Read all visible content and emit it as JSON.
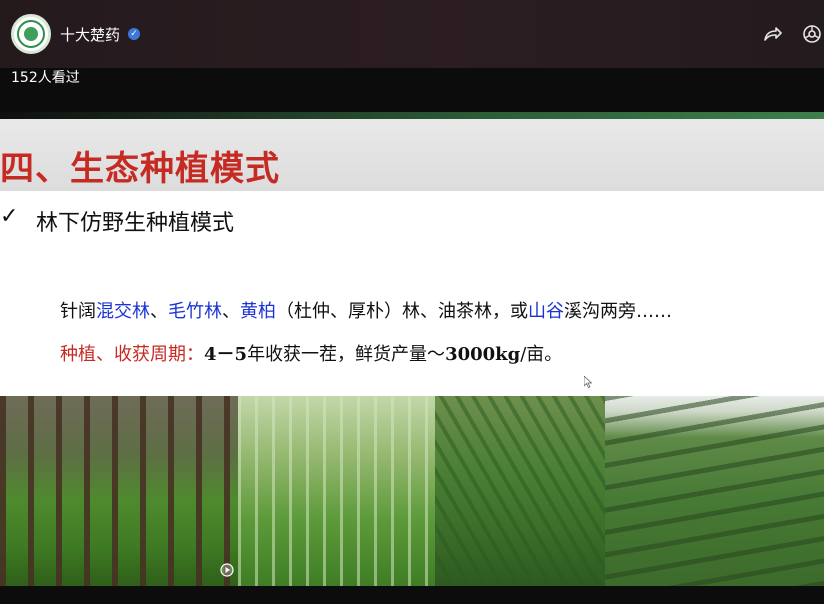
{
  "header": {
    "account_name": "十大楚药",
    "verified_badge": "✓",
    "icons": [
      "logo",
      "verified-icon",
      "share-icon",
      "more-icon"
    ]
  },
  "view_count": "152人看过",
  "slide": {
    "title": "四、生态种植模式",
    "check_mark": "✓",
    "subheading": "林下仿野生种植模式",
    "forest_types": [
      {
        "text": "针阔",
        "highlight": false
      },
      {
        "text": "混交林",
        "highlight": true
      },
      {
        "text": "、",
        "highlight": false
      },
      {
        "text": "毛竹林",
        "highlight": true
      },
      {
        "text": "、",
        "highlight": false
      },
      {
        "text": "黄柏",
        "highlight": true
      },
      {
        "text": "（杜仲、厚朴）林、油茶林，或",
        "highlight": false
      },
      {
        "text": "山谷",
        "highlight": true
      },
      {
        "text": "溪沟两旁……",
        "highlight": false
      }
    ],
    "cycle_label": "种植、收获周期：",
    "cycle_years": "4－5",
    "cycle_text": "年收获一茬，鲜货产量～",
    "yield_value": "3000kg",
    "yield_unit": "/亩。"
  },
  "colors": {
    "title_red": "#c62b23",
    "highlight_blue": "#1b34d6",
    "accent_green": "#3d7f4b"
  }
}
